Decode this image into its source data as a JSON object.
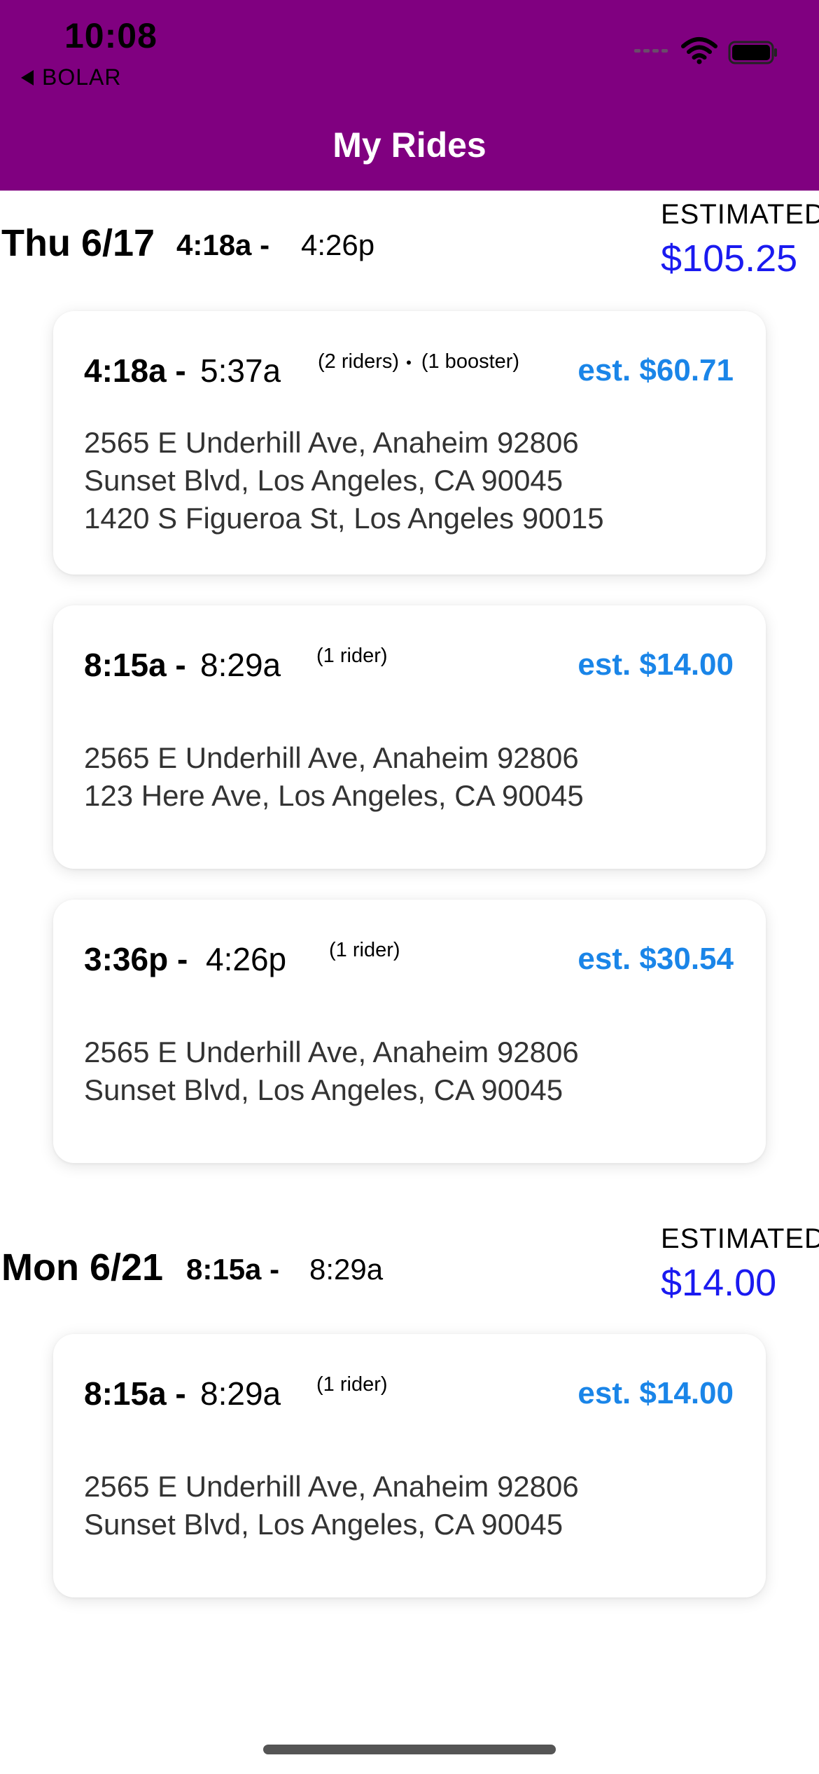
{
  "status_bar": {
    "time": "10:08",
    "back_label": "BOLAR"
  },
  "nav": {
    "title": "My Rides"
  },
  "days": [
    {
      "date": "Thu 6/17",
      "start": "4:18a -",
      "end": "4:26p",
      "estimated_label": "ESTIMATED",
      "estimated_total": "$105.25",
      "rides": [
        {
          "start": "4:18a -",
          "end": "5:37a",
          "riders": "(2 riders)",
          "separator": "•",
          "boosters": "(1 booster)",
          "price": "est. $60.71",
          "addresses": [
            "2565 E Underhill Ave, Anaheim 92806",
            "Sunset Blvd, Los Angeles, CA 90045",
            "1420 S Figueroa St, Los Angeles 90015"
          ]
        },
        {
          "start": "8:15a -",
          "end": "8:29a",
          "riders": "(1 rider)",
          "price": "est. $14.00",
          "addresses": [
            "2565 E Underhill Ave, Anaheim 92806",
            "123 Here Ave, Los Angeles, CA 90045"
          ]
        },
        {
          "start": "3:36p -",
          "end": "4:26p",
          "riders": "(1 rider)",
          "price": "est. $30.54",
          "addresses": [
            "2565 E Underhill Ave, Anaheim 92806",
            "Sunset Blvd, Los Angeles, CA 90045"
          ]
        }
      ]
    },
    {
      "date": "Mon 6/21",
      "start": "8:15a -",
      "end": "8:29a",
      "estimated_label": "ESTIMATED",
      "estimated_total": "$14.00",
      "rides": [
        {
          "start": "8:15a -",
          "end": "8:29a",
          "riders": "(1 rider)",
          "price": "est. $14.00",
          "addresses": [
            "2565 E Underhill Ave, Anaheim 92806",
            "Sunset Blvd, Los Angeles, CA 90045"
          ]
        }
      ]
    }
  ],
  "colors": {
    "header_bg": "#800080",
    "estimated_total": "#1a1af0",
    "ride_price": "#1a85e8"
  }
}
